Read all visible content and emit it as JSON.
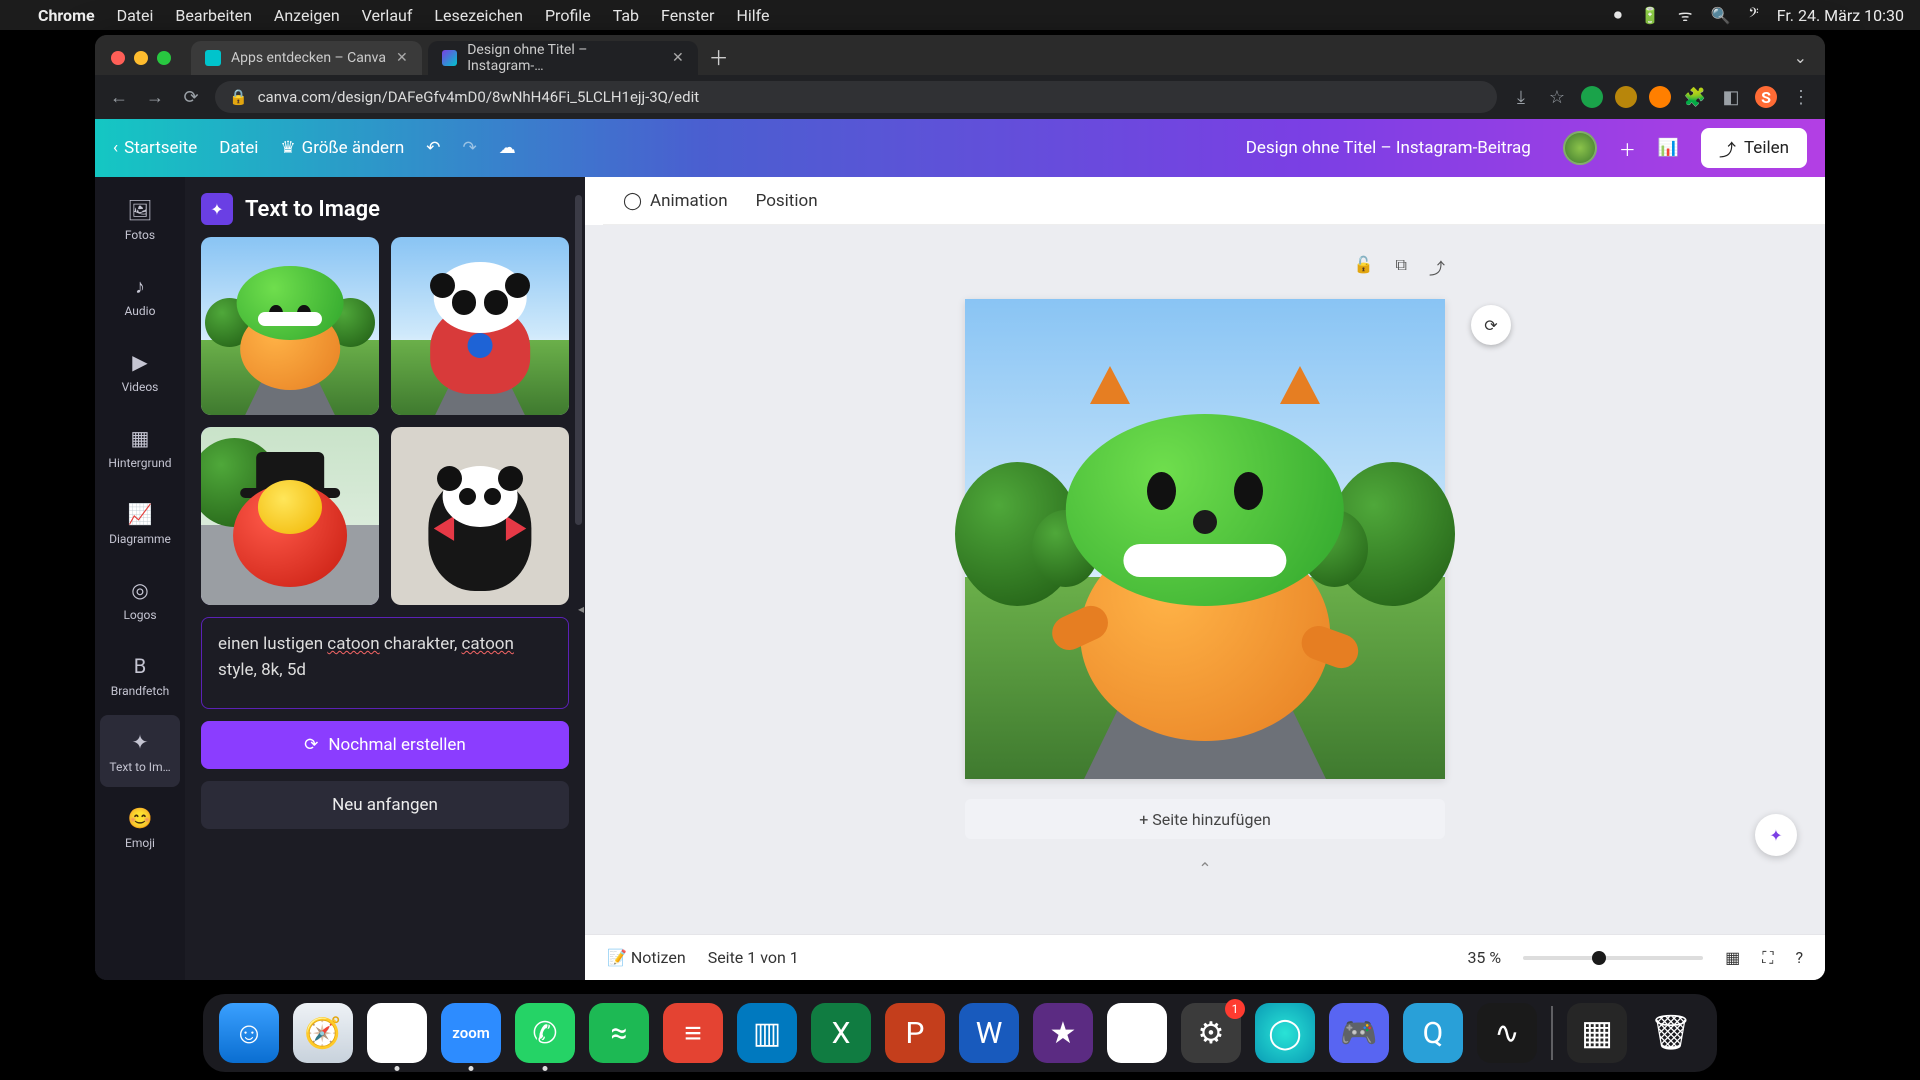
{
  "menubar": {
    "app": "Chrome",
    "items": [
      "Datei",
      "Bearbeiten",
      "Anzeigen",
      "Verlauf",
      "Lesezeichen",
      "Profile",
      "Tab",
      "Fenster",
      "Hilfe"
    ],
    "clock": "Fr. 24. März  10:30"
  },
  "browser": {
    "tabs": [
      {
        "title": "Apps entdecken – Canva",
        "active": false
      },
      {
        "title": "Design ohne Titel – Instagram-…",
        "active": true
      }
    ],
    "url": "canva.com/design/DAFeGfv4mD0/8wNhH46Fi_5LCLH1ejj-3Q/edit"
  },
  "canva": {
    "home": "Startseite",
    "file": "Datei",
    "resize": "Größe ändern",
    "doc_title": "Design ohne Titel – Instagram-Beitrag",
    "share": "Teilen",
    "sidenav": [
      {
        "id": "fotos",
        "label": "Fotos",
        "icon": "🖼"
      },
      {
        "id": "audio",
        "label": "Audio",
        "icon": "♪"
      },
      {
        "id": "videos",
        "label": "Videos",
        "icon": "▶"
      },
      {
        "id": "hintergrund",
        "label": "Hintergrund",
        "icon": "▦"
      },
      {
        "id": "diagramme",
        "label": "Diagramme",
        "icon": "📈"
      },
      {
        "id": "logos",
        "label": "Logos",
        "icon": "◎"
      },
      {
        "id": "brandfetch",
        "label": "Brandfetch",
        "icon": "B"
      },
      {
        "id": "text-to-image",
        "label": "Text to Im…",
        "icon": "✦",
        "active": true
      },
      {
        "id": "emoji",
        "label": "Emoji",
        "icon": "😊"
      }
    ],
    "panel": {
      "title": "Text to Image",
      "prompt_pre": "einen lustigen ",
      "prompt_u1": "catoon",
      "prompt_mid": " charakter, ",
      "prompt_u2": "catoon",
      "prompt_post": " style, 8k, 5d",
      "regenerate": "Nochmal erstellen",
      "restart": "Neu anfangen",
      "thumbs": [
        {
          "id": "green-cat",
          "selected": false
        },
        {
          "id": "panda-robot",
          "selected": false
        },
        {
          "id": "red-ball-hat",
          "selected": true
        },
        {
          "id": "panda-bowtie",
          "selected": false
        }
      ]
    },
    "page_tools": {
      "animation": "Animation",
      "position": "Position"
    },
    "add_page": "+ Seite hinzufügen",
    "footer": {
      "notes": "Notizen",
      "page": "Seite 1 von 1",
      "zoom": "35 %"
    }
  },
  "dock": {
    "apps": [
      {
        "id": "finder",
        "bg": "linear-gradient(#3aa0ff,#0a6ed1)",
        "glyph": "☺"
      },
      {
        "id": "safari",
        "bg": "linear-gradient(#eef2f6,#c8d2dc)",
        "glyph": "🧭"
      },
      {
        "id": "chrome",
        "bg": "#fff",
        "glyph": "◉",
        "running": true
      },
      {
        "id": "zoom",
        "bg": "#2d8cff",
        "glyph": "zoom",
        "text": true,
        "running": true
      },
      {
        "id": "whatsapp",
        "bg": "#25d366",
        "glyph": "✆",
        "running": true
      },
      {
        "id": "spotify",
        "bg": "#1db954",
        "glyph": "≈"
      },
      {
        "id": "todoist",
        "bg": "#e44332",
        "glyph": "≡"
      },
      {
        "id": "trello",
        "bg": "#0079bf",
        "glyph": "▥"
      },
      {
        "id": "excel",
        "bg": "#107c41",
        "glyph": "X"
      },
      {
        "id": "powerpoint",
        "bg": "#c43e1c",
        "glyph": "P"
      },
      {
        "id": "word",
        "bg": "#185abd",
        "glyph": "W"
      },
      {
        "id": "imovie",
        "bg": "#5b2b82",
        "glyph": "★"
      },
      {
        "id": "drive",
        "bg": "#fff",
        "glyph": "▲"
      },
      {
        "id": "settings",
        "bg": "#3b3b3b",
        "glyph": "⚙",
        "badge": "1"
      },
      {
        "id": "siri",
        "bg": "radial-gradient(circle,#29e3d6,#0a9bb5)",
        "glyph": "◯"
      },
      {
        "id": "discord",
        "bg": "#5865f2",
        "glyph": "🎮"
      },
      {
        "id": "quicktime",
        "bg": "#29a0d8",
        "glyph": "Q"
      },
      {
        "id": "voice",
        "bg": "#1a1a1a",
        "glyph": "∿"
      }
    ],
    "right": [
      {
        "id": "mission",
        "bg": "#262626",
        "glyph": "▦"
      },
      {
        "id": "trash",
        "bg": "transparent",
        "glyph": "🗑"
      }
    ]
  }
}
